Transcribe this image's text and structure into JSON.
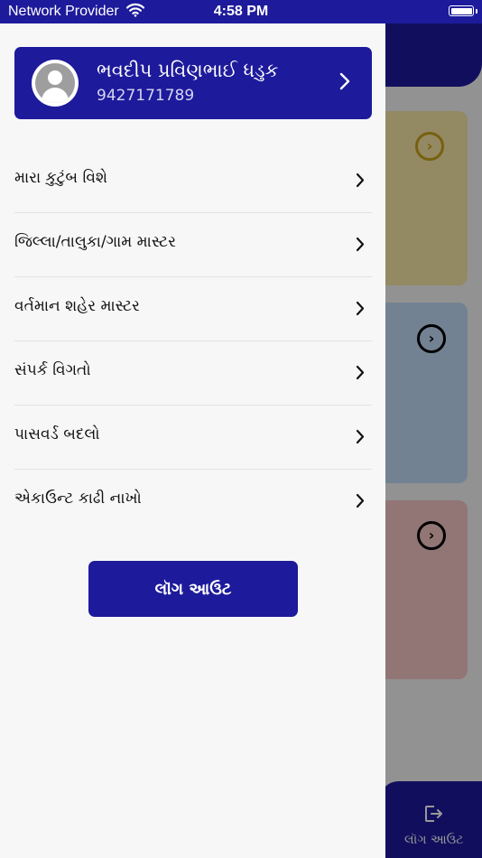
{
  "status_bar": {
    "carrier": "Network Provider",
    "time": "4:58 PM"
  },
  "profile": {
    "name": "ભવદીપ પ્રવિણભાઈ ધડુક",
    "phone": "9427171789"
  },
  "menu": {
    "items": [
      {
        "label": "મારા કુટુંબ વિશે"
      },
      {
        "label": "જિલ્લા/તાલુકા/ગામ માસ્ટર"
      },
      {
        "label": "વર્તમાન શહેર માસ્ટર"
      },
      {
        "label": "સંપર્ક વિગતો"
      },
      {
        "label": "પાસવર્ડ બદલો"
      },
      {
        "label": "એકાઉન્ટ કાઢી નાખો"
      }
    ]
  },
  "logout_button": {
    "label": "લૉગ આઉટ"
  },
  "background": {
    "bottom_nav_label": "લૉગ આઉટ"
  },
  "colors": {
    "primary": "#1d1a9c",
    "card_yellow": "#f6e4a6",
    "card_blue": "#bfd9f3",
    "card_pink": "#f4c3c3"
  }
}
